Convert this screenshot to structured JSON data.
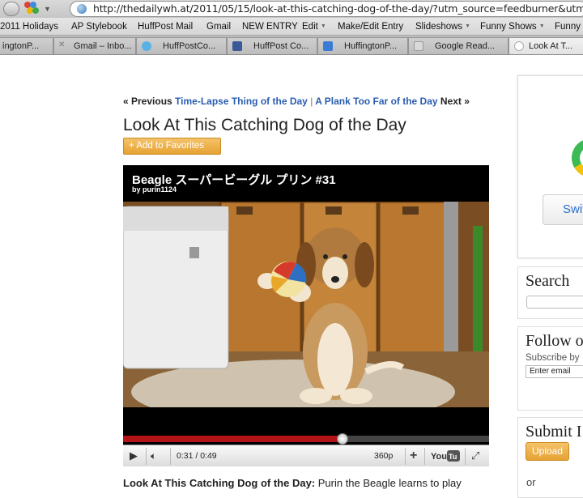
{
  "browser": {
    "url": "http://thedailywh.at/2011/05/15/look-at-this-catching-dog-of-the-day/?utm_source=feedburner&utm_medium",
    "bookmarks": [
      {
        "label": "2011 Holidays",
        "menu": false
      },
      {
        "label": "AP Stylebook",
        "menu": false
      },
      {
        "label": "HuffPost Mail",
        "menu": false
      },
      {
        "label": "Gmail",
        "menu": false
      },
      {
        "label": "NEW ENTRY",
        "menu": false
      },
      {
        "label": "Edit",
        "menu": true
      },
      {
        "label": "Make/Edit Entry",
        "menu": false
      },
      {
        "label": "Slideshows",
        "menu": true
      },
      {
        "label": "Funny Shows",
        "menu": true
      },
      {
        "label": "Funny S",
        "menu": false
      }
    ],
    "tabs": [
      {
        "label": "ingtonP...",
        "icon": "none"
      },
      {
        "label": "Gmail – Inbo...",
        "icon": "gmail-icon"
      },
      {
        "label": "HuffPostCo...",
        "icon": "twitter-icon"
      },
      {
        "label": "HuffPost Co...",
        "icon": "facebook-icon"
      },
      {
        "label": "HuffingtonP...",
        "icon": "huffpost-icon"
      },
      {
        "label": "Google Read...",
        "icon": "google-reader-icon"
      },
      {
        "label": "Look At T...",
        "icon": "page-icon"
      }
    ]
  },
  "article": {
    "nav": {
      "prev_prefix": "« Previous",
      "prev_link": "Time-Lapse Thing of the Day",
      "separator": "|",
      "next_link": "A Plank Too Far of the Day",
      "next_suffix": "Next »"
    },
    "title": "Look At This Catching Dog of the Day",
    "favorites_button": "+ Add to Favorites",
    "video": {
      "title": "Beagle スーパービーグル プリン #31",
      "byline": "by purin1124",
      "time": "0:31 / 0:49",
      "quality": "360p",
      "progress": 0.6
    },
    "caption_bold": "Look At This Catching Dog of the Day:",
    "caption_text": " Purin the Beagle learns to play"
  },
  "sidebar": {
    "switch_button": "Swit",
    "search_title": "Search",
    "follow_title": "Follow o",
    "follow_subtitle": "Subscribe by",
    "email_placeholder": "Enter email",
    "submit_title": "Submit I",
    "upload_button": "Upload",
    "or_text": "or"
  }
}
